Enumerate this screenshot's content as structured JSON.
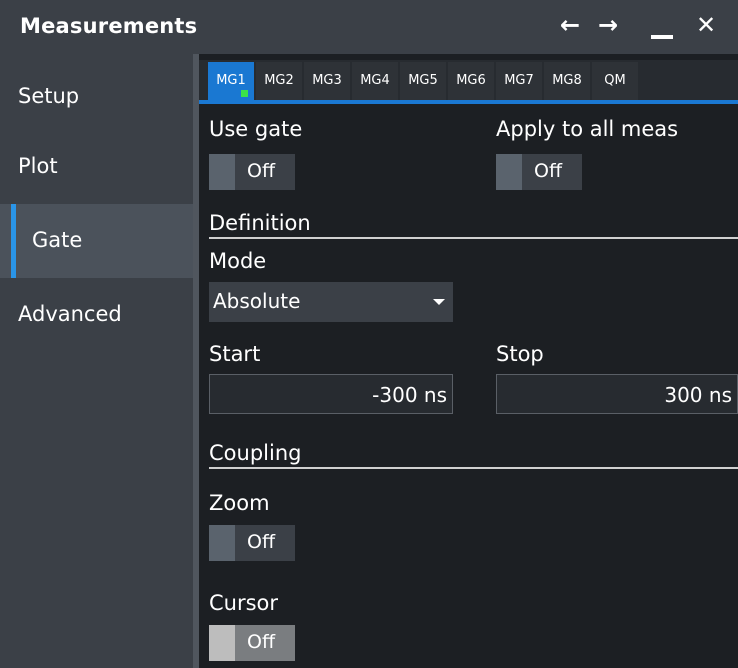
{
  "window": {
    "title": "Measurements"
  },
  "titlebar_icons": [
    "arrow-left-icon",
    "arrow-right-icon",
    "minimize-icon",
    "close-icon"
  ],
  "sidebar": {
    "items": [
      {
        "label": "Setup"
      },
      {
        "label": "Plot"
      },
      {
        "label": "Gate"
      },
      {
        "label": "Advanced"
      }
    ],
    "active": "Gate"
  },
  "tabs": [
    {
      "label": "MG1"
    },
    {
      "label": "MG2"
    },
    {
      "label": "MG3"
    },
    {
      "label": "MG4"
    },
    {
      "label": "MG5"
    },
    {
      "label": "MG6"
    },
    {
      "label": "MG7"
    },
    {
      "label": "MG8"
    },
    {
      "label": "QM"
    }
  ],
  "active_tab": "MG1",
  "use_gate": {
    "label": "Use gate",
    "value": "Off"
  },
  "apply_all": {
    "label": "Apply to all meas",
    "value": "Off"
  },
  "definition": {
    "heading": "Definition",
    "mode_label": "Mode",
    "mode_value": "Absolute"
  },
  "start": {
    "label": "Start",
    "value": "-300 ns"
  },
  "stop": {
    "label": "Stop",
    "value": "300 ns"
  },
  "coupling": {
    "heading": "Coupling"
  },
  "zoom": {
    "label": "Zoom",
    "value": "Off"
  },
  "cursor": {
    "label": "Cursor",
    "value": "Off"
  },
  "colors": {
    "accent": "#1a78d2",
    "active_indicator": "#3be34a",
    "sidebar_bar": "#2a95e8"
  }
}
